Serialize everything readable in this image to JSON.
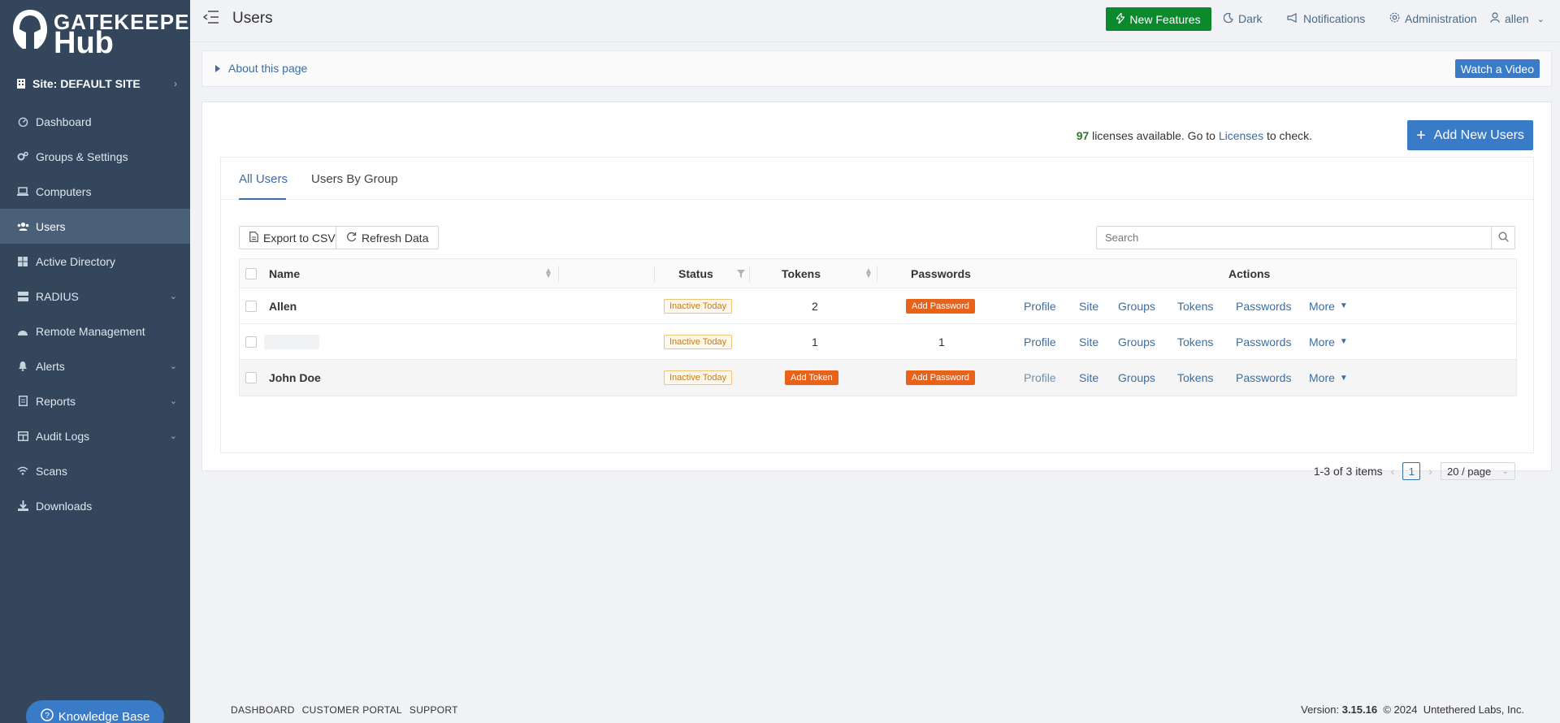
{
  "logo": {
    "line1": "GATEKEEPER",
    "line2": "Hub"
  },
  "site": {
    "label": "Site: DEFAULT SITE"
  },
  "sidebar": {
    "items": [
      {
        "label": "Dashboard",
        "icon": "dashboard-icon",
        "expandable": false
      },
      {
        "label": "Groups & Settings",
        "icon": "cogs-icon",
        "expandable": false
      },
      {
        "label": "Computers",
        "icon": "laptop-icon",
        "expandable": false
      },
      {
        "label": "Users",
        "icon": "users-icon",
        "expandable": false,
        "active": true
      },
      {
        "label": "Active Directory",
        "icon": "windows-icon",
        "expandable": false
      },
      {
        "label": "RADIUS",
        "icon": "server-icon",
        "expandable": true
      },
      {
        "label": "Remote Management",
        "icon": "dome-icon",
        "expandable": false
      },
      {
        "label": "Alerts",
        "icon": "bell-icon",
        "expandable": true
      },
      {
        "label": "Reports",
        "icon": "report-icon",
        "expandable": true
      },
      {
        "label": "Audit Logs",
        "icon": "table-icon",
        "expandable": true
      },
      {
        "label": "Scans",
        "icon": "wifi-icon",
        "expandable": false
      },
      {
        "label": "Downloads",
        "icon": "download-icon",
        "expandable": false
      }
    ],
    "knowledge_base": "Knowledge Base"
  },
  "header": {
    "title": "Users",
    "new_features": "New Features",
    "dark": "Dark",
    "notifications": "Notifications",
    "administration": "Administration",
    "user": "allen"
  },
  "about": {
    "label": "About this page",
    "watch_video": "Watch a Video"
  },
  "licenses": {
    "count": "97",
    "text_before": " licenses available. Go to ",
    "link": "Licenses",
    "text_after": " to check.",
    "add_users": "Add New Users"
  },
  "tabs": [
    {
      "label": "All Users",
      "active": true
    },
    {
      "label": "Users By Group",
      "active": false
    }
  ],
  "toolbar": {
    "export": "Export to CSV",
    "refresh": "Refresh Data",
    "search_placeholder": "Search"
  },
  "table": {
    "columns": {
      "name": "Name",
      "status": "Status",
      "tokens": "Tokens",
      "passwords": "Passwords",
      "actions": "Actions"
    },
    "actions": [
      "Profile",
      "Site",
      "Groups",
      "Tokens",
      "Passwords",
      "More"
    ],
    "rows": [
      {
        "name": "Allen",
        "status": "Inactive Today",
        "tokens": "2",
        "tokens_button": "",
        "passwords": "",
        "passwords_button": "Add Password"
      },
      {
        "name": "",
        "status": "Inactive Today",
        "tokens": "1",
        "tokens_button": "",
        "passwords": "1",
        "passwords_button": ""
      },
      {
        "name": "John Doe",
        "status": "Inactive Today",
        "tokens": "",
        "tokens_button": "Add Token",
        "passwords": "",
        "passwords_button": "Add Password"
      }
    ]
  },
  "pagination": {
    "summary": "1-3 of 3 items",
    "current_page": "1",
    "page_size": "20 / page"
  },
  "footer": {
    "links": [
      "DASHBOARD",
      "CUSTOMER PORTAL",
      "SUPPORT"
    ],
    "version_label": "Version:",
    "version": "3.15.16",
    "copyright": "© 2024",
    "company": "Untethered Labs, Inc."
  }
}
